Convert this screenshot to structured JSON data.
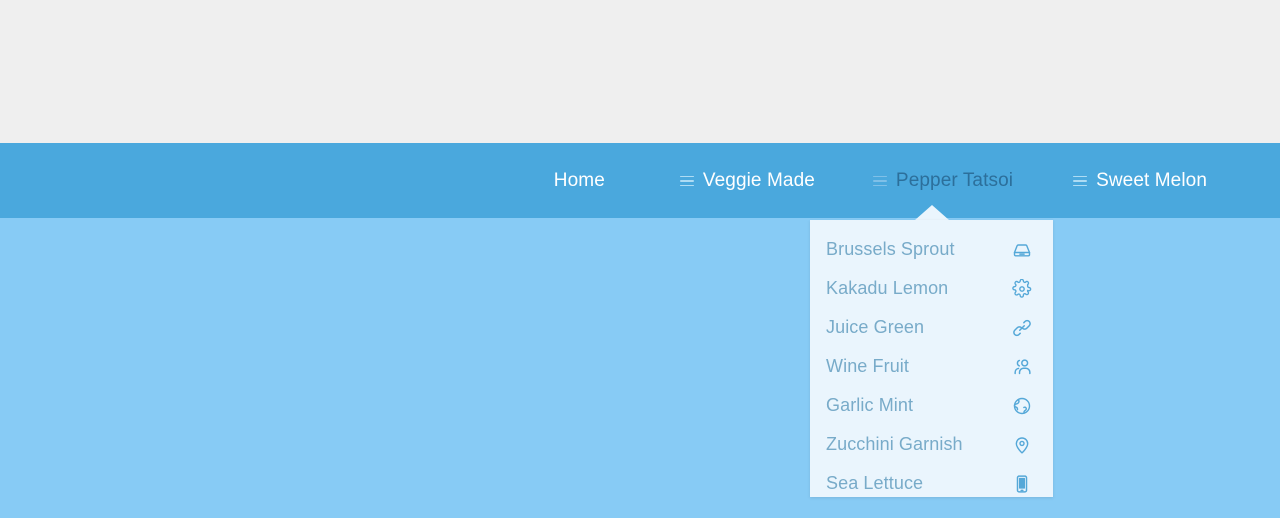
{
  "page": {
    "background_top": "#efefef",
    "background_body": "#87cbf5"
  },
  "navbar": {
    "background": "#4aa8dd",
    "text_color": "#ffffff",
    "active_color": "#2c6f9b",
    "items": [
      {
        "label": "Home",
        "icon": "",
        "active": false
      },
      {
        "label": "Veggie Made",
        "icon": "hamburger-icon",
        "active": false
      },
      {
        "label": "Pepper Tatsoi",
        "icon": "hamburger-icon",
        "active": true
      },
      {
        "label": "Sweet Melon",
        "icon": "hamburger-icon",
        "active": false
      }
    ]
  },
  "dropdown": {
    "background": "#eaf5fd",
    "label_color": "#78abc9",
    "icon_color": "#55a8d8",
    "parent": "Pepper Tatsoi",
    "items": [
      {
        "label": "Brussels Sprout",
        "icon": "hard-drive-icon"
      },
      {
        "label": "Kakadu Lemon",
        "icon": "gear-icon"
      },
      {
        "label": "Juice Green",
        "icon": "link-icon"
      },
      {
        "label": "Wine Fruit",
        "icon": "users-icon"
      },
      {
        "label": "Garlic Mint",
        "icon": "globe-icon"
      },
      {
        "label": "Zucchini Garnish",
        "icon": "map-pin-icon"
      },
      {
        "label": "Sea Lettuce",
        "icon": "mobile-icon"
      }
    ]
  }
}
